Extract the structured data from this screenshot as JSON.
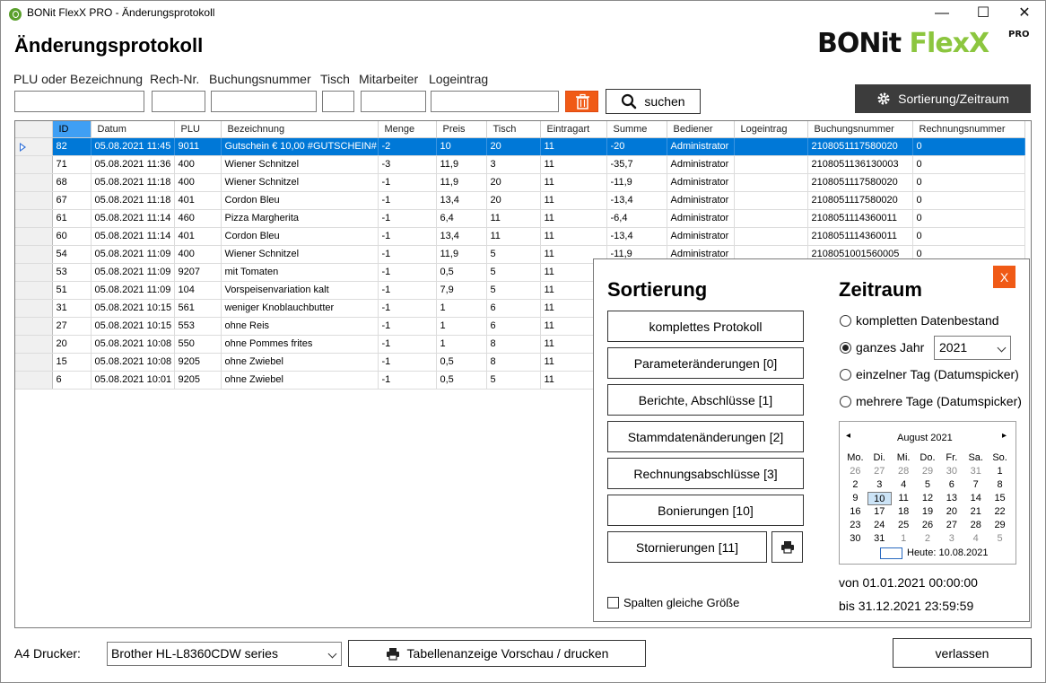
{
  "window": {
    "title": "BONit FlexX PRO - Änderungsprotokoll",
    "minimize": "—",
    "maximize": "☐",
    "close": "✕"
  },
  "page_title": "Änderungsprotokoll",
  "logo": {
    "bonit": "BONit ",
    "flexx": "FlexX",
    "pro": "PRO"
  },
  "filters": {
    "plu_label": "PLU oder Bezeichnung",
    "rech_label": "Rech-Nr.",
    "buchung_label": "Buchungsnummer",
    "tisch_label": "Tisch",
    "mitarbeiter_label": "Mitarbeiter",
    "log_label": "Logeintrag",
    "search_label": "suchen",
    "sort_button": "Sortierung/Zeitraum"
  },
  "table": {
    "columns": [
      "ID",
      "Datum",
      "PLU",
      "Bezeichnung",
      "Menge",
      "Preis",
      "Tisch",
      "Eintragart",
      "Summe",
      "Bediener",
      "Logeintrag",
      "Buchungsnummer",
      "Rechnungsnummer"
    ],
    "rows": [
      [
        "82",
        "05.08.2021 11:45",
        "9011",
        "Gutschein € 10,00 #GUTSCHEIN#",
        "-2",
        "10",
        "20",
        "11",
        "-20",
        "Administrator",
        "",
        "2108051117580020",
        "0"
      ],
      [
        "71",
        "05.08.2021 11:36",
        "400",
        "Wiener Schnitzel",
        "-3",
        "11,9",
        "3",
        "11",
        "-35,7",
        "Administrator",
        "",
        "2108051136130003",
        "0"
      ],
      [
        "68",
        "05.08.2021 11:18",
        "400",
        "Wiener Schnitzel",
        "-1",
        "11,9",
        "20",
        "11",
        "-11,9",
        "Administrator",
        "",
        "2108051117580020",
        "0"
      ],
      [
        "67",
        "05.08.2021 11:18",
        "401",
        "Cordon Bleu",
        "-1",
        "13,4",
        "20",
        "11",
        "-13,4",
        "Administrator",
        "",
        "2108051117580020",
        "0"
      ],
      [
        "61",
        "05.08.2021 11:14",
        "460",
        "Pizza Margherita",
        "-1",
        "6,4",
        "11",
        "11",
        "-6,4",
        "Administrator",
        "",
        "2108051114360011",
        "0"
      ],
      [
        "60",
        "05.08.2021 11:14",
        "401",
        "Cordon Bleu",
        "-1",
        "13,4",
        "11",
        "11",
        "-13,4",
        "Administrator",
        "",
        "2108051114360011",
        "0"
      ],
      [
        "54",
        "05.08.2021 11:09",
        "400",
        "Wiener Schnitzel",
        "-1",
        "11,9",
        "5",
        "11",
        "-11,9",
        "Administrator",
        "",
        "2108051001560005",
        "0"
      ],
      [
        "53",
        "05.08.2021 11:09",
        "9207",
        "mit Tomaten",
        "-1",
        "0,5",
        "5",
        "11",
        "",
        "",
        "",
        "",
        ""
      ],
      [
        "51",
        "05.08.2021 11:09",
        "104",
        "Vorspeisenvariation kalt",
        "-1",
        "7,9",
        "5",
        "11",
        "",
        "",
        "",
        "",
        ""
      ],
      [
        "31",
        "05.08.2021 10:15",
        "561",
        "weniger Knoblauchbutter",
        "-1",
        "1",
        "6",
        "11",
        "",
        "",
        "",
        "",
        ""
      ],
      [
        "27",
        "05.08.2021 10:15",
        "553",
        "ohne Reis",
        "-1",
        "1",
        "6",
        "11",
        "",
        "",
        "",
        "",
        ""
      ],
      [
        "20",
        "05.08.2021 10:08",
        "550",
        "ohne Pommes frites",
        "-1",
        "1",
        "8",
        "11",
        "",
        "",
        "",
        "",
        ""
      ],
      [
        "15",
        "05.08.2021 10:08",
        "9205",
        "ohne Zwiebel",
        "-1",
        "0,5",
        "8",
        "11",
        "",
        "",
        "",
        "",
        ""
      ],
      [
        "6",
        "05.08.2021 10:01",
        "9205",
        "ohne Zwiebel",
        "-1",
        "0,5",
        "5",
        "11",
        "",
        "",
        "",
        "",
        ""
      ]
    ]
  },
  "panel": {
    "close_label": "X",
    "sort_title": "Sortierung",
    "buttons": [
      "komplettes Protokoll",
      "Parameteränderungen [0]",
      "Berichte, Abschlüsse [1]",
      "Stammdatenänderungen [2]",
      "Rechnungsabschlüsse [3]",
      "Bonierungen [10]",
      "Stornierungen [11]"
    ],
    "equal_columns_label": "Spalten gleiche Größe",
    "time_title": "Zeitraum",
    "radio_full": "kompletten Datenbestand",
    "radio_year": "ganzes Jahr",
    "year_value": "2021",
    "radio_day": "einzelner Tag (Datumspicker)",
    "radio_days": "mehrere Tage (Datumspicker)",
    "calendar": {
      "month": "August 2021",
      "prev": "◂",
      "next": "▸",
      "weekdays": [
        "Mo.",
        "Di.",
        "Mi.",
        "Do.",
        "Fr.",
        "Sa.",
        "So."
      ],
      "days": [
        [
          "26",
          "dim"
        ],
        [
          "27",
          "dim"
        ],
        [
          "28",
          "dim"
        ],
        [
          "29",
          "dim"
        ],
        [
          "30",
          "dim"
        ],
        [
          "31",
          "dim"
        ],
        [
          "1",
          ""
        ],
        [
          "2",
          ""
        ],
        [
          "3",
          ""
        ],
        [
          "4",
          ""
        ],
        [
          "5",
          ""
        ],
        [
          "6",
          ""
        ],
        [
          "7",
          ""
        ],
        [
          "8",
          ""
        ],
        [
          "9",
          ""
        ],
        [
          "10",
          "today"
        ],
        [
          "11",
          ""
        ],
        [
          "12",
          ""
        ],
        [
          "13",
          ""
        ],
        [
          "14",
          ""
        ],
        [
          "15",
          ""
        ],
        [
          "16",
          ""
        ],
        [
          "17",
          ""
        ],
        [
          "18",
          ""
        ],
        [
          "19",
          ""
        ],
        [
          "20",
          ""
        ],
        [
          "21",
          ""
        ],
        [
          "22",
          ""
        ],
        [
          "23",
          ""
        ],
        [
          "24",
          ""
        ],
        [
          "25",
          ""
        ],
        [
          "26",
          ""
        ],
        [
          "27",
          ""
        ],
        [
          "28",
          ""
        ],
        [
          "29",
          ""
        ],
        [
          "30",
          ""
        ],
        [
          "31",
          ""
        ],
        [
          "1",
          "dim"
        ],
        [
          "2",
          "dim"
        ],
        [
          "3",
          "dim"
        ],
        [
          "4",
          "dim"
        ],
        [
          "5",
          "dim"
        ]
      ],
      "today_label": "Heute: 10.08.2021"
    },
    "from_label": "von 01.01.2021 00:00:00",
    "to_label": "bis 31.12.2021 23:59:59"
  },
  "bottom": {
    "printer_label": "A4 Drucker:",
    "printer_value": "Brother HL-L8360CDW series",
    "preview_label": "Tabellenanzeige Vorschau / drucken",
    "exit_label": "verlassen"
  },
  "colors": {
    "accent_orange": "#f05a16",
    "selection_blue": "#0078d7",
    "header_highlight": "#3f9ff4",
    "logo_green": "#8cc63f",
    "dark_button": "#3c3c3c"
  }
}
